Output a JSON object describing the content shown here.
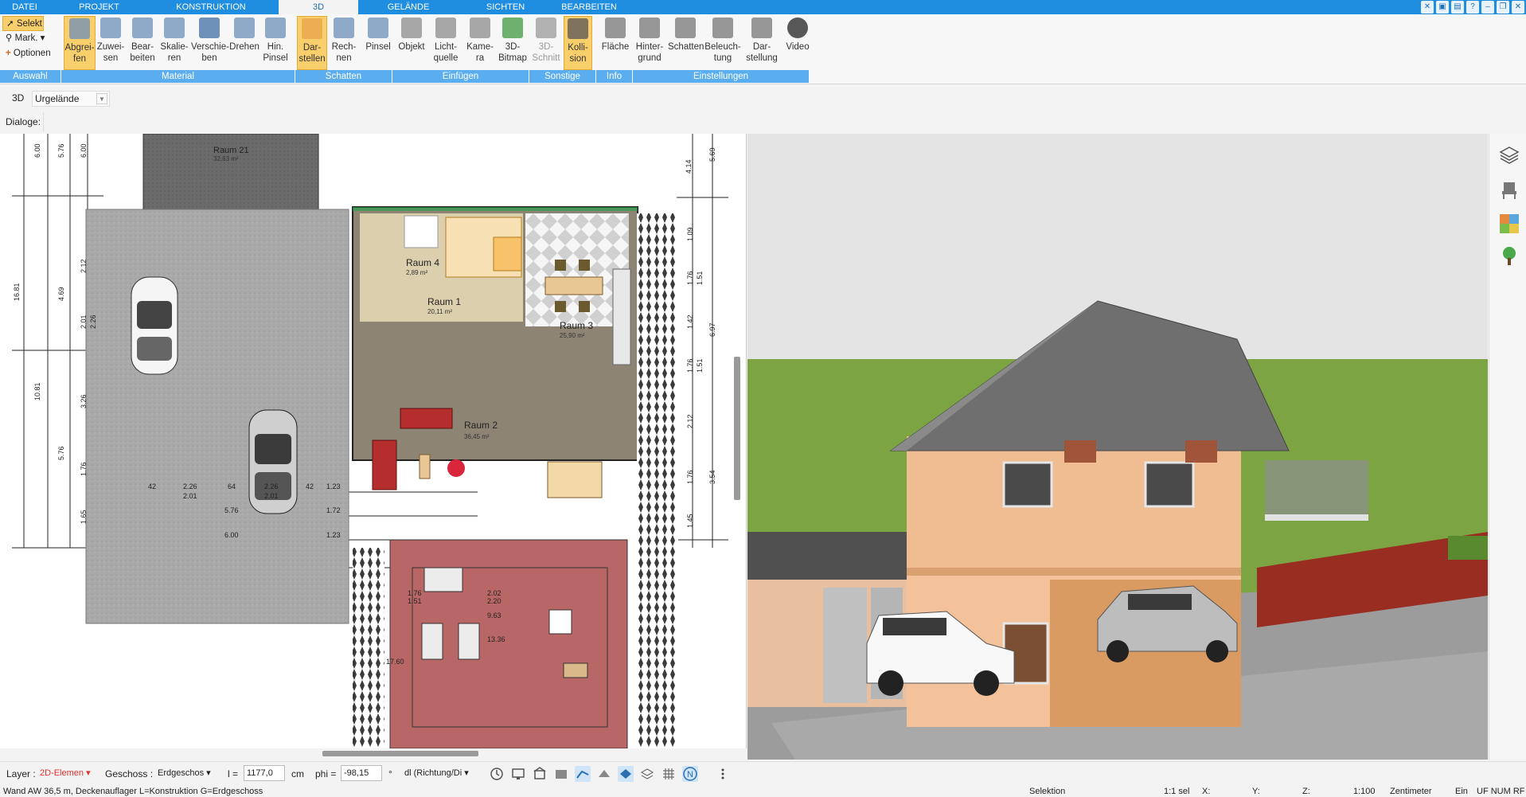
{
  "menu": {
    "tabs": [
      "DATEI",
      "PROJEKT",
      "KONSTRUKTION",
      "3D",
      "GELÄNDE",
      "SICHTEN",
      "BEARBEITEN"
    ],
    "active_tab": "3D"
  },
  "ribbon": {
    "selection": {
      "selekt": "Selekt",
      "mark": "Mark.",
      "optionen": "Optionen"
    },
    "buttons": [
      {
        "l1": "Abgrei-",
        "l2": "fen"
      },
      {
        "l1": "Zuwei-",
        "l2": "sen"
      },
      {
        "l1": "Bear-",
        "l2": "beiten"
      },
      {
        "l1": "Skalie-",
        "l2": "ren"
      },
      {
        "l1": "Verschie-",
        "l2": "ben"
      },
      {
        "l1": "Drehen",
        "l2": ""
      },
      {
        "l1": "Hin.",
        "l2": "Pinsel"
      },
      {
        "l1": "Dar-",
        "l2": "stellen"
      },
      {
        "l1": "Rech-",
        "l2": "nen"
      },
      {
        "l1": "Pinsel",
        "l2": ""
      },
      {
        "l1": "Objekt",
        "l2": ""
      },
      {
        "l1": "Licht-",
        "l2": "quelle"
      },
      {
        "l1": "Kame-",
        "l2": "ra"
      },
      {
        "l1": "3D-",
        "l2": "Bitmap"
      },
      {
        "l1": "3D-",
        "l2": "Schnitt"
      },
      {
        "l1": "Kolli-",
        "l2": "sion"
      },
      {
        "l1": "Fläche",
        "l2": ""
      },
      {
        "l1": "Hinter-",
        "l2": "grund"
      },
      {
        "l1": "Schatten",
        "l2": ""
      },
      {
        "l1": "Beleuch-",
        "l2": "tung"
      },
      {
        "l1": "Dar-",
        "l2": "stellung"
      },
      {
        "l1": "Video",
        "l2": ""
      }
    ],
    "groups": [
      "Auswahl",
      "Material",
      "Schatten",
      "Einfügen",
      "Sonstige",
      "Info",
      "Einstellungen"
    ]
  },
  "toolbar3d": {
    "label": "3D",
    "terrain_combo": "Urgelände"
  },
  "dialoge": {
    "label": "Dialoge:"
  },
  "plan": {
    "rooms": [
      {
        "name": "Raum 21",
        "area": "32,63 m²"
      },
      {
        "name": "Raum 4",
        "area": "2,89 m²"
      },
      {
        "name": "Raum 1",
        "area": "20,11 m²"
      },
      {
        "name": "Raum 3",
        "area": "25,90 m²"
      },
      {
        "name": "Raum 2",
        "area": "36,45 m²"
      }
    ],
    "dims_left": [
      "6.00",
      "5.76",
      "6.00",
      "16.81",
      "2.12",
      "4.69",
      "2.01",
      "2.26",
      "10.81",
      "3.26",
      "5.76",
      "1.76",
      "1.65"
    ],
    "dims_right": [
      "4.14",
      "5.69",
      "1.09",
      "1.76",
      "1.51",
      "1.42",
      "6.97",
      "1.76",
      "1.51",
      "2.12",
      "1.76",
      "3.54",
      "1.45"
    ],
    "dims_bottom": [
      "42",
      "2.26",
      "64",
      "2.26",
      "42",
      "1.23",
      "2.01",
      "2.01",
      "5.76",
      "1.72",
      "6.00",
      "1.23",
      "1.76",
      "1.51",
      "2.02",
      "2.20",
      "9.63",
      "13.36",
      "17.60"
    ]
  },
  "bottom": {
    "layer_label": "Layer :",
    "layer_value": "2D-Elemen",
    "geschoss_label": "Geschoss :",
    "geschoss_value": "Erdgeschos",
    "l_label": "l =",
    "l_value": "1177,0",
    "l_unit": "cm",
    "phi_label": "phi =",
    "phi_value": "-98,15",
    "phi_unit": "°",
    "dl_value": "dl (Richtung/Di"
  },
  "status": {
    "message": "Wand AW 36,5 m, Deckenauflager L=Konstruktion G=Erdgeschoss",
    "mode": "Selektion",
    "sel": "1:1 sel",
    "x": "X:",
    "y": "Y:",
    "z": "Z:",
    "scale": "1:100",
    "unit": "Zentimeter",
    "ein": "Ein",
    "flags": "UF NUM RF"
  },
  "colors": {
    "accent": "#1f8de0",
    "group": "#5aaef0",
    "active_btn": "#f9cf6b"
  }
}
